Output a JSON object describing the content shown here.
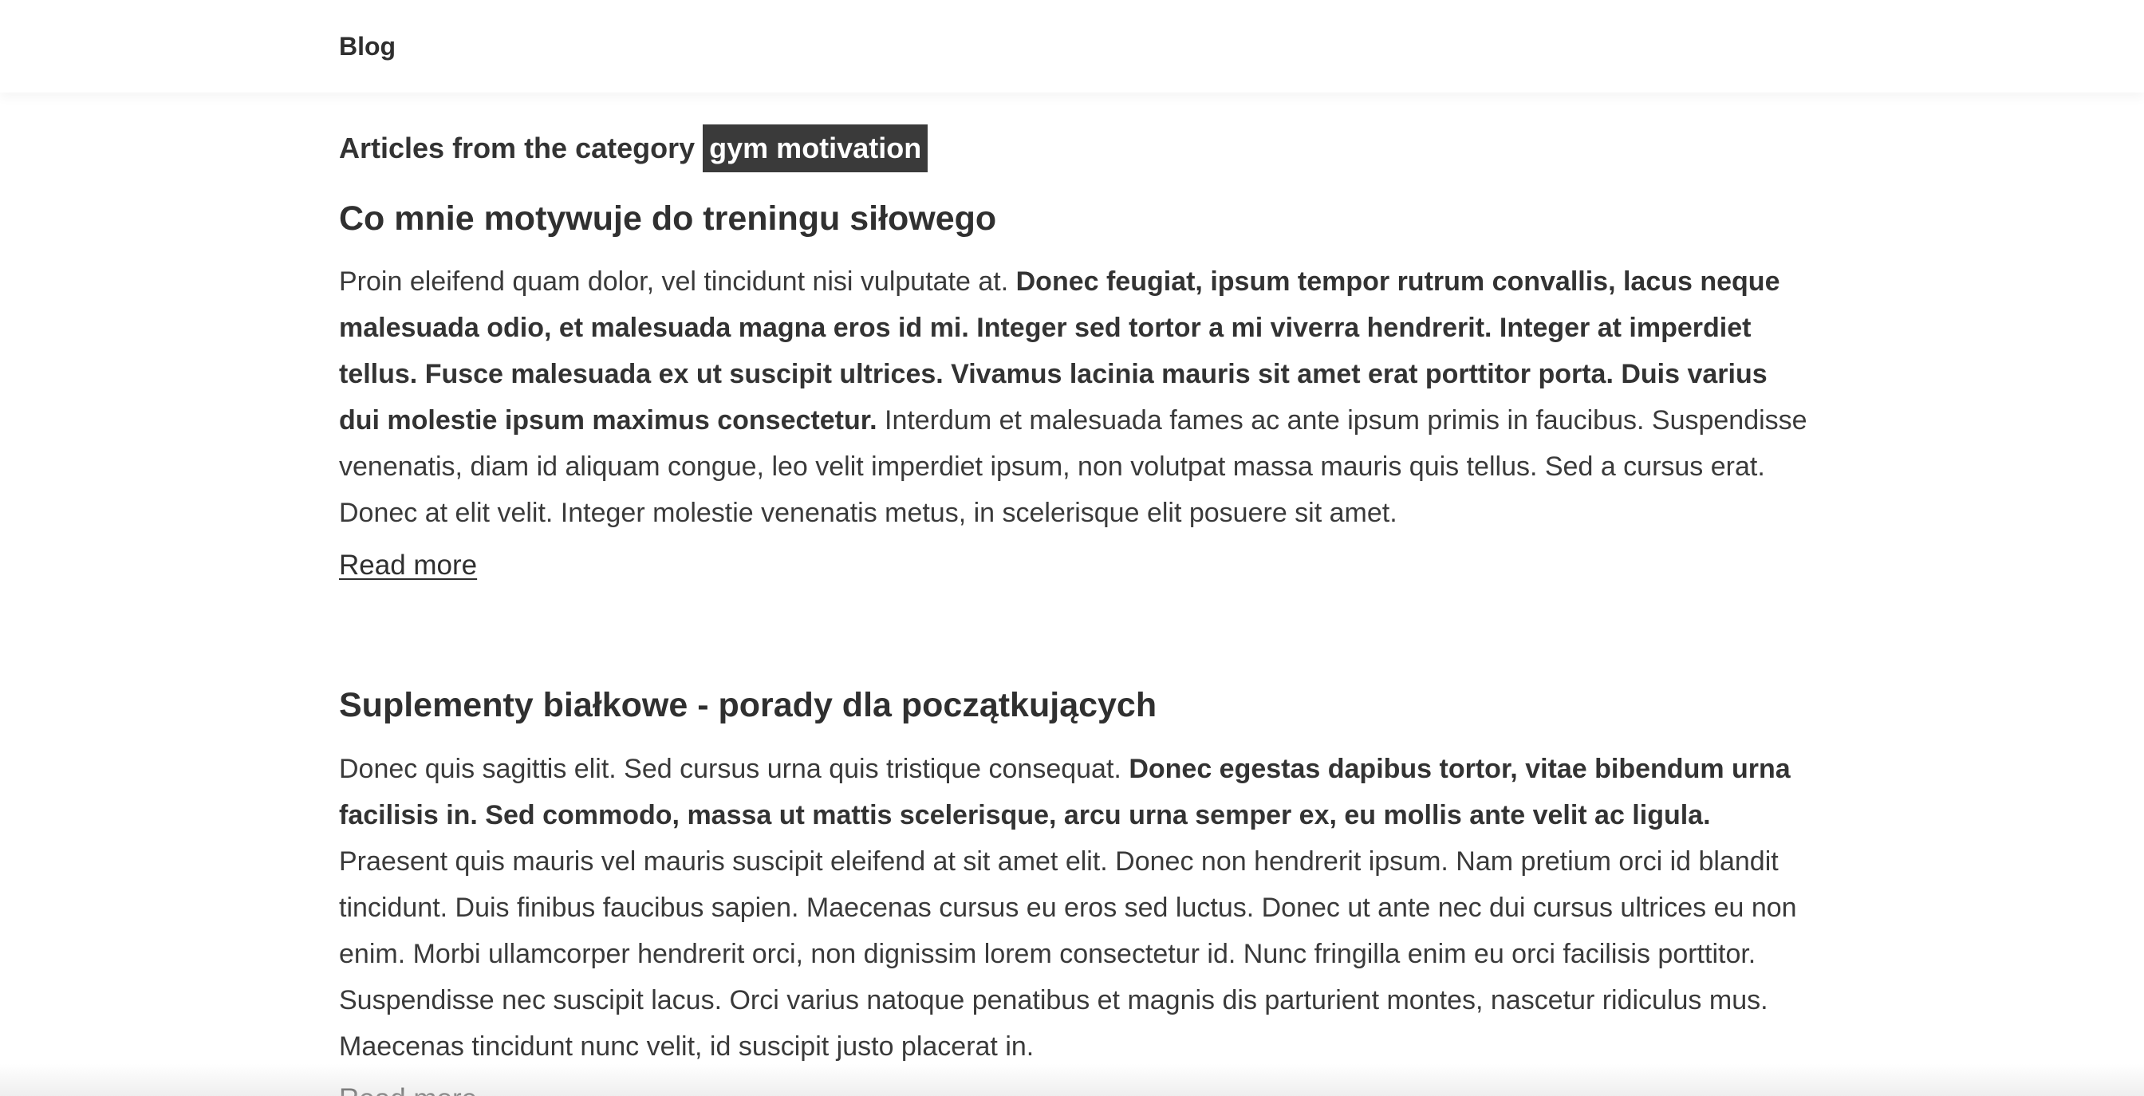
{
  "header": {
    "brand": "Blog"
  },
  "category": {
    "prefix": "Articles from the category",
    "name": "gym motivation"
  },
  "articles": [
    {
      "title": "Co mnie motywuje do treningu siłowego",
      "intro": "Proin eleifend quam dolor, vel tincidunt nisi vulputate at. ",
      "bold": "Donec feugiat, ipsum tempor rutrum convallis, lacus neque malesuada odio, et malesuada magna eros id mi. Integer sed tortor a mi viverra hendrerit. Integer at imperdiet tellus. Fusce malesuada ex ut suscipit ultrices. Vivamus lacinia mauris sit amet erat porttitor porta. Duis varius dui molestie ipsum maximus consectetur.",
      "rest": " Interdum et malesuada fames ac ante ipsum primis in faucibus. Suspendisse venenatis, diam id aliquam congue, leo velit imperdiet ipsum, non volutpat massa mauris quis tellus. Sed a cursus erat. Donec at elit velit. Integer molestie venenatis metus, in scelerisque elit posuere sit amet.",
      "read_more": "Read more"
    },
    {
      "title": "Suplementy białkowe - porady dla początkujących",
      "intro": "Donec quis sagittis elit. Sed cursus urna quis tristique consequat. ",
      "bold": "Donec egestas dapibus tortor, vitae bibendum urna facilisis in. Sed commodo, massa ut mattis scelerisque, arcu urna semper ex, eu mollis ante velit ac ligula.",
      "rest": " Praesent quis mauris vel mauris suscipit eleifend at sit amet elit. Donec non hendrerit ipsum. Nam pretium orci id blandit tincidunt. Duis finibus faucibus sapien. Maecenas cursus eu eros sed luctus. Donec ut ante nec dui cursus ultrices eu non enim. Morbi ullamcorper hendrerit orci, non dignissim lorem consectetur id. Nunc fringilla enim eu orci facilisis porttitor. Suspendisse nec suscipit lacus. Orci varius natoque penatibus et magnis dis parturient montes, nascetur ridiculus mus. Maecenas tincidunt nunc velit, id suscipit justo placerat in.",
      "read_more": "Read more"
    }
  ],
  "colors": {
    "text": "#333333",
    "tag_background": "#3a3a3a",
    "tag_text": "#ffffff",
    "background": "#ffffff"
  }
}
